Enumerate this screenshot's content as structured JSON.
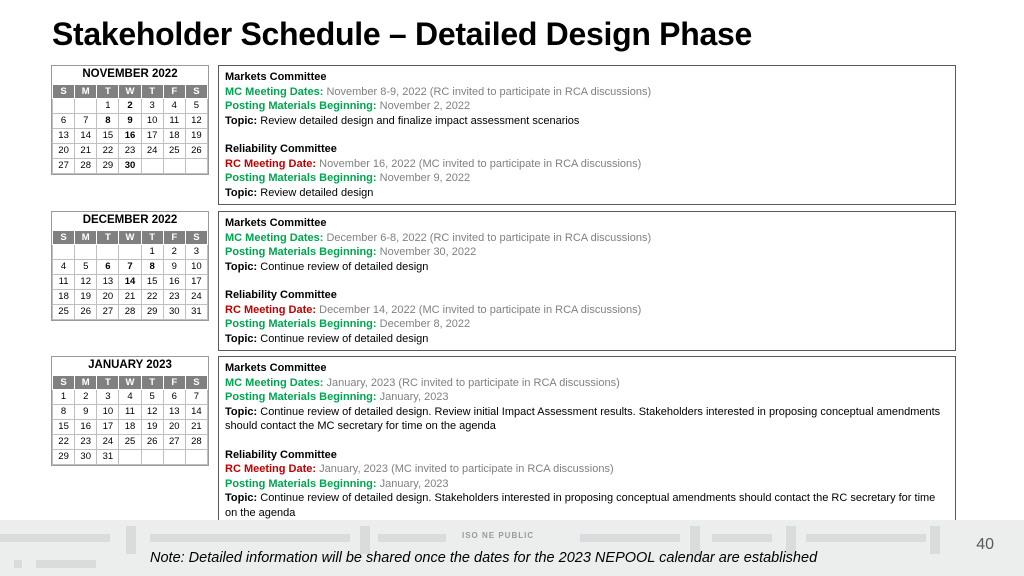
{
  "title": "Stakeholder Schedule – Detailed Design Phase",
  "footer": {
    "classification": "ISO NE PUBLIC",
    "page_number": "40",
    "note": "Note: Detailed information will be shared once the dates for the 2023 NEPOOL calendar are established"
  },
  "weekday_headers": [
    "S",
    "M",
    "T",
    "W",
    "T",
    "F",
    "S"
  ],
  "calendars": [
    {
      "title": "NOVEMBER 2022",
      "weeks": [
        [
          {
            "d": ""
          },
          {
            "d": ""
          },
          {
            "d": "1"
          },
          {
            "d": "2",
            "hl": "green"
          },
          {
            "d": "3"
          },
          {
            "d": "4"
          },
          {
            "d": "5"
          }
        ],
        [
          {
            "d": "6"
          },
          {
            "d": "7"
          },
          {
            "d": "8",
            "hl": "blue"
          },
          {
            "d": "9",
            "hl": "green"
          },
          {
            "d": "10"
          },
          {
            "d": "11"
          },
          {
            "d": "12"
          }
        ],
        [
          {
            "d": "13"
          },
          {
            "d": "14"
          },
          {
            "d": "15"
          },
          {
            "d": "16",
            "hl": "red"
          },
          {
            "d": "17"
          },
          {
            "d": "18"
          },
          {
            "d": "19"
          }
        ],
        [
          {
            "d": "20"
          },
          {
            "d": "21"
          },
          {
            "d": "22"
          },
          {
            "d": "23"
          },
          {
            "d": "24"
          },
          {
            "d": "25"
          },
          {
            "d": "26"
          }
        ],
        [
          {
            "d": "27"
          },
          {
            "d": "28"
          },
          {
            "d": "29"
          },
          {
            "d": "30",
            "hl": "green"
          },
          {
            "d": ""
          },
          {
            "d": ""
          },
          {
            "d": ""
          }
        ]
      ]
    },
    {
      "title": "DECEMBER 2022",
      "weeks": [
        [
          {
            "d": ""
          },
          {
            "d": ""
          },
          {
            "d": ""
          },
          {
            "d": ""
          },
          {
            "d": "1"
          },
          {
            "d": "2"
          },
          {
            "d": "3"
          }
        ],
        [
          {
            "d": "4"
          },
          {
            "d": "5"
          },
          {
            "d": "6",
            "hl": "blue"
          },
          {
            "d": "7",
            "hl": "blue"
          },
          {
            "d": "8",
            "hl": "green"
          },
          {
            "d": "9"
          },
          {
            "d": "10"
          }
        ],
        [
          {
            "d": "11"
          },
          {
            "d": "12"
          },
          {
            "d": "13"
          },
          {
            "d": "14",
            "hl": "red"
          },
          {
            "d": "15"
          },
          {
            "d": "16"
          },
          {
            "d": "17"
          }
        ],
        [
          {
            "d": "18"
          },
          {
            "d": "19"
          },
          {
            "d": "20"
          },
          {
            "d": "21"
          },
          {
            "d": "22"
          },
          {
            "d": "23"
          },
          {
            "d": "24"
          }
        ],
        [
          {
            "d": "25"
          },
          {
            "d": "26"
          },
          {
            "d": "27"
          },
          {
            "d": "28"
          },
          {
            "d": "29"
          },
          {
            "d": "30"
          },
          {
            "d": "31"
          }
        ]
      ]
    },
    {
      "title": "JANUARY 2023",
      "weeks": [
        [
          {
            "d": "1"
          },
          {
            "d": "2"
          },
          {
            "d": "3"
          },
          {
            "d": "4"
          },
          {
            "d": "5"
          },
          {
            "d": "6"
          },
          {
            "d": "7"
          }
        ],
        [
          {
            "d": "8"
          },
          {
            "d": "9"
          },
          {
            "d": "10"
          },
          {
            "d": "11"
          },
          {
            "d": "12"
          },
          {
            "d": "13"
          },
          {
            "d": "14"
          }
        ],
        [
          {
            "d": "15"
          },
          {
            "d": "16"
          },
          {
            "d": "17"
          },
          {
            "d": "18"
          },
          {
            "d": "19"
          },
          {
            "d": "20"
          },
          {
            "d": "21"
          }
        ],
        [
          {
            "d": "22"
          },
          {
            "d": "23"
          },
          {
            "d": "24"
          },
          {
            "d": "25"
          },
          {
            "d": "26"
          },
          {
            "d": "27"
          },
          {
            "d": "28"
          }
        ],
        [
          {
            "d": "29"
          },
          {
            "d": "30"
          },
          {
            "d": "31"
          },
          {
            "d": ""
          },
          {
            "d": ""
          },
          {
            "d": ""
          },
          {
            "d": ""
          }
        ]
      ]
    }
  ],
  "notes": [
    {
      "markets": {
        "header": "Markets Committee",
        "meeting_label": "MC Meeting Dates:",
        "meeting_value": "November 8-9, 2022 (RC invited to participate in RCA discussions)",
        "posting_label": "Posting Materials Beginning:",
        "posting_value": "November 2, 2022",
        "topic_label": "Topic:",
        "topic_value": "Review detailed design and finalize impact assessment scenarios"
      },
      "reliability": {
        "header": "Reliability Committee",
        "meeting_label": "RC Meeting Date:",
        "meeting_value": "November 16, 2022 (MC invited to participate in RCA discussions)",
        "posting_label": "Posting Materials Beginning:",
        "posting_value": "November 9, 2022",
        "topic_label": "Topic:",
        "topic_value": "Review detailed design"
      }
    },
    {
      "markets": {
        "header": "Markets Committee",
        "meeting_label": "MC Meeting Dates:",
        "meeting_value": "December 6-8, 2022 (RC invited to participate in RCA discussions)",
        "posting_label": "Posting Materials Beginning:",
        "posting_value": "November 30, 2022",
        "topic_label": "Topic:",
        "topic_value": "Continue review of detailed design"
      },
      "reliability": {
        "header": "Reliability Committee",
        "meeting_label": "RC Meeting Date:",
        "meeting_value": "December 14, 2022 (MC invited to participate in RCA discussions)",
        "posting_label": "Posting Materials Beginning:",
        "posting_value": "December 8, 2022",
        "topic_label": "Topic:",
        "topic_value": "Continue review of detailed design"
      }
    },
    {
      "markets": {
        "header": "Markets Committee",
        "meeting_label": "MC Meeting Dates:",
        "meeting_value": "January, 2023 (RC invited to participate in RCA discussions)",
        "posting_label": "Posting Materials Beginning:",
        "posting_value": "January, 2023",
        "topic_label": "Topic:",
        "topic_value": "Continue review of detailed design. Review initial Impact Assessment results. Stakeholders interested in proposing conceptual amendments should contact the MC secretary for time on the agenda"
      },
      "reliability": {
        "header": "Reliability Committee",
        "meeting_label": "RC Meeting Date:",
        "meeting_value": "January, 2023 (MC invited to participate in RCA discussions)",
        "posting_label": "Posting Materials Beginning:",
        "posting_value": "January, 2023",
        "topic_label": "Topic:",
        "topic_value": "Continue review of detailed design. Stakeholders interested in proposing conceptual amendments should contact the RC secretary for time on the agenda"
      }
    }
  ]
}
